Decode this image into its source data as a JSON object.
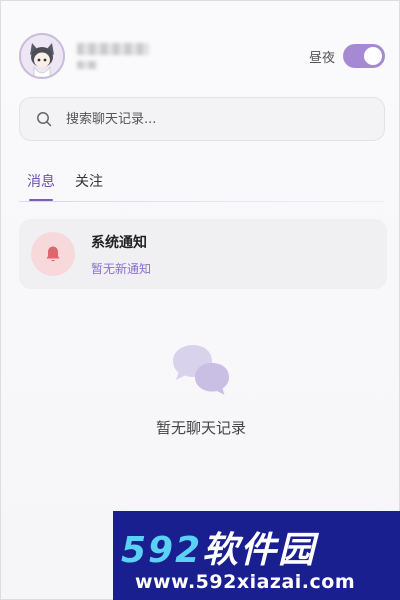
{
  "header": {
    "daynight_label": "昼夜",
    "toggle_on": true
  },
  "search": {
    "placeholder": "搜索聊天记录..."
  },
  "tabs": [
    {
      "label": "消息",
      "active": true
    },
    {
      "label": "关注",
      "active": false
    }
  ],
  "notice": {
    "title": "系统通知",
    "subtitle": "暂无新通知"
  },
  "empty_state": {
    "label": "暂无聊天记录"
  },
  "watermark": {
    "brand_number": "592",
    "brand_text": "软件园",
    "url": "www.592xiazai.com"
  },
  "colors": {
    "accent": "#7b5cc2",
    "toggle": "#a58ad3",
    "bell": "#e0666e",
    "watermark_bg": "#1a1f8f"
  }
}
